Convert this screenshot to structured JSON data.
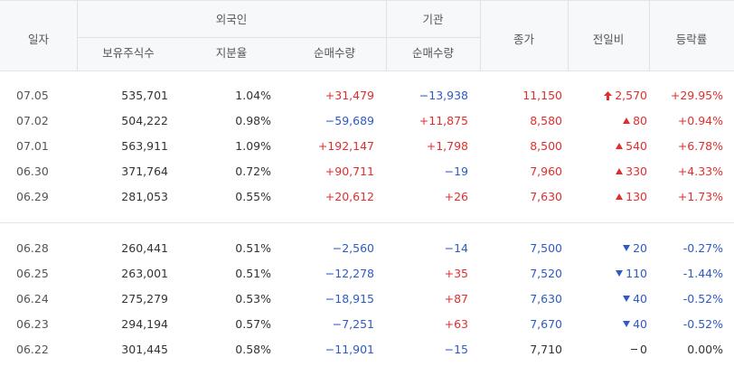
{
  "header": {
    "date": "일자",
    "foreign": "외국인",
    "institution": "기관",
    "close": "종가",
    "change": "전일비",
    "rate": "등락률",
    "holdings": "보유주식수",
    "ratio": "지분율",
    "foreign_net": "순매수량",
    "inst_net": "순매수량"
  },
  "rows": [
    {
      "date": "07.05",
      "holdings": "535,701",
      "ratio": "1.04%",
      "foreign_net": "+31,479",
      "inst_net": "−13,938",
      "close": "11,150",
      "change": "2,570",
      "rate": "+29.95%"
    },
    {
      "date": "07.02",
      "holdings": "504,222",
      "ratio": "0.98%",
      "foreign_net": "−59,689",
      "inst_net": "+11,875",
      "close": "8,580",
      "change": "80",
      "rate": "+0.94%"
    },
    {
      "date": "07.01",
      "holdings": "563,911",
      "ratio": "1.09%",
      "foreign_net": "+192,147",
      "inst_net": "+1,798",
      "close": "8,500",
      "change": "540",
      "rate": "+6.78%"
    },
    {
      "date": "06.30",
      "holdings": "371,764",
      "ratio": "0.72%",
      "foreign_net": "+90,711",
      "inst_net": "−19",
      "close": "7,960",
      "change": "330",
      "rate": "+4.33%"
    },
    {
      "date": "06.29",
      "holdings": "281,053",
      "ratio": "0.55%",
      "foreign_net": "+20,612",
      "inst_net": "+26",
      "close": "7,630",
      "change": "130",
      "rate": "+1.73%"
    },
    {
      "date": "06.28",
      "holdings": "260,441",
      "ratio": "0.51%",
      "foreign_net": "−2,560",
      "inst_net": "−14",
      "close": "7,500",
      "change": "20",
      "rate": "-0.27%"
    },
    {
      "date": "06.25",
      "holdings": "263,001",
      "ratio": "0.51%",
      "foreign_net": "−12,278",
      "inst_net": "+35",
      "close": "7,520",
      "change": "110",
      "rate": "-1.44%"
    },
    {
      "date": "06.24",
      "holdings": "275,279",
      "ratio": "0.53%",
      "foreign_net": "−18,915",
      "inst_net": "+87",
      "close": "7,630",
      "change": "40",
      "rate": "-0.52%"
    },
    {
      "date": "06.23",
      "holdings": "294,194",
      "ratio": "0.57%",
      "foreign_net": "−7,251",
      "inst_net": "+63",
      "close": "7,670",
      "change": "40",
      "rate": "-0.52%"
    },
    {
      "date": "06.22",
      "holdings": "301,445",
      "ratio": "0.58%",
      "foreign_net": "−11,901",
      "inst_net": "−15",
      "close": "7,710",
      "change": "0",
      "rate": "0.00%"
    }
  ],
  "colors": {
    "up": "#e22d2d",
    "down": "#2d5ac8",
    "flat": "#333333"
  }
}
